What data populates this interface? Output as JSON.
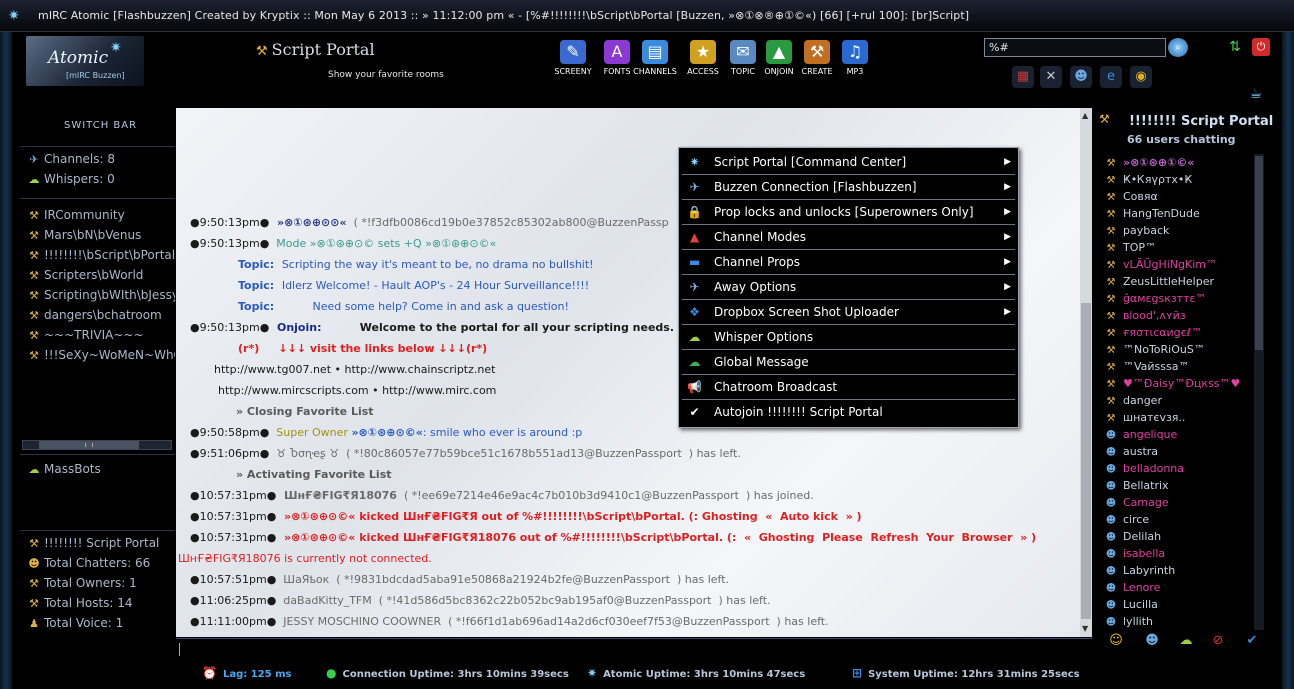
{
  "window": {
    "title": "mIRC Atomic [Flashbuzzen] Created by Kryptix :: Mon May 6 2013 :: » 11:12:00 pm « - [%#!!!!!!!!\\bScript\\bPortal [Buzzen, »⊗①⊗®⊕①©«) [66] [+rul 100]: [br]Script]"
  },
  "header": {
    "logo_text": "Atomic",
    "logo_sub": "[mIRC Buzzen]",
    "portal_title": "Script Portal",
    "portal_subtitle": "Show your favorite rooms",
    "toolbar": [
      {
        "name": "screeny",
        "label": "SCREENY",
        "glyph": "✎",
        "color": "#3a6ad0"
      },
      {
        "name": "fonts",
        "label": "FONTS",
        "glyph": "A",
        "color": "#8a3ad0"
      },
      {
        "name": "channels",
        "label": "CHANNELS",
        "glyph": "▤",
        "color": "#3a8ae0"
      },
      {
        "name": "access",
        "label": "ACCESS",
        "glyph": "★",
        "color": "#d0a020"
      },
      {
        "name": "topic",
        "label": "TOPIC",
        "glyph": "✉",
        "color": "#5a88c0"
      },
      {
        "name": "onjoin",
        "label": "ONJOIN",
        "glyph": "▲",
        "color": "#2a9a40"
      },
      {
        "name": "create",
        "label": "CREATE",
        "glyph": "⚒",
        "color": "#c07020"
      },
      {
        "name": "mp3",
        "label": "MP3",
        "glyph": "♫",
        "color": "#2a6ad0"
      }
    ],
    "search_value": "%#",
    "hicons": [
      {
        "name": "users-grid-icon",
        "glyph": "▦",
        "color": "#c03a3a"
      },
      {
        "name": "tools-icon",
        "glyph": "✕",
        "color": "#c8c8c8"
      },
      {
        "name": "group-icon",
        "glyph": "☻",
        "color": "#6aa8e0"
      },
      {
        "name": "ie-icon",
        "glyph": "e",
        "color": "#3a8ae0"
      },
      {
        "name": "chrome-icon",
        "glyph": "◉",
        "color": "#e0b020"
      }
    ]
  },
  "sidebar": {
    "switch_bar_label": "SWITCH BAR",
    "stats": [
      {
        "label": "Channels: 8",
        "glyph": "✈"
      },
      {
        "label": "Whispers: 0",
        "glyph": "☁"
      }
    ],
    "channels": [
      "IRCommunity",
      "Mars\\bN\\bVenus",
      "!!!!!!!!\\bScript\\bPortal",
      "Scripters\\bWorld",
      "Scripting\\bWIth\\bJessy",
      "dangers\\bchatroom",
      "~~~TRIVIA~~~",
      "!!!SeXy~WoMeN~WhO~\\"
    ],
    "massbots": "MassBots",
    "room_info": [
      {
        "label": "!!!!!!!! Script Portal",
        "glyph": "⚒"
      },
      {
        "label": "Total Chatters: 66",
        "glyph": "☻"
      },
      {
        "label": "Total Owners: 1",
        "glyph": "⚒"
      },
      {
        "label": "Total Hosts: 14",
        "glyph": "⚒"
      },
      {
        "label": "Total Voice: 1",
        "glyph": "♟"
      }
    ]
  },
  "chat": {
    "lines": [
      {
        "ts": "●9:50:13pm●",
        "parts": [
          {
            "t": "  »⊗①⊛⊕⊙⊙«",
            "c": "#2a3a8a",
            "b": true
          },
          {
            "t": "  ( *!f3dfb0086cd19b0e37852c85302ab800@BuzzenPassp",
            "c": "#6a6a6a"
          }
        ]
      },
      {
        "ts": "●9:50:13pm●",
        "parts": [
          {
            "t": "  Mode »⊗①⊛⊕⊙© sets +Q »⊗①⊛⊕⊙©«",
            "c": "#3a9a8a"
          }
        ]
      },
      {
        "ts": "",
        "indent": 48,
        "parts": [
          {
            "t": "Topic:  ",
            "c": "#2a5ac0",
            "b": true
          },
          {
            "t": "Scripting the way it's meant to be, no drama no bullshit!",
            "c": "#2a5ac0"
          }
        ]
      },
      {
        "ts": "",
        "indent": 48,
        "parts": [
          {
            "t": "Topic:  ",
            "c": "#2a5ac0",
            "b": true
          },
          {
            "t": "Idlerz Welcome! - Hault AOP's - 24 Hour Surveillance!!!!",
            "c": "#2a5ac0"
          }
        ]
      },
      {
        "ts": "",
        "indent": 48,
        "parts": [
          {
            "t": "Topic:          ",
            "c": "#2a5ac0",
            "b": true
          },
          {
            "t": "Need some help? Come in and ask a question!",
            "c": "#2a5ac0"
          }
        ]
      },
      {
        "ts": "●9:50:13pm●",
        "parts": [
          {
            "t": "  Onjoin:          ",
            "c": "#1a2a8a",
            "b": true
          },
          {
            "t": "Welcome to the portal for all your scripting needs. (~)",
            "c": "#1a1a1a",
            "b": true
          }
        ]
      },
      {
        "ts": "",
        "indent": 48,
        "parts": [
          {
            "t": "(r*)     ↓↓↓ visit the links below ↓↓↓(r*)",
            "c": "#e02020",
            "b": true
          }
        ]
      },
      {
        "ts": "",
        "indent": 24,
        "parts": [
          {
            "t": "http://www.tg007.net • http://www.chainscriptz.net",
            "c": "#1a1a1a"
          }
        ]
      },
      {
        "ts": "",
        "indent": 28,
        "parts": [
          {
            "t": "http://www.mircscripts.com • http://www.mirc.com",
            "c": "#1a1a1a"
          }
        ]
      },
      {
        "ts": "",
        "indent": 46,
        "parts": [
          {
            "t": "» Closing Favorite List",
            "c": "#5a5a5a",
            "b": true
          }
        ]
      },
      {
        "ts": "●9:50:58pm●",
        "parts": [
          {
            "t": "  Super Owner ",
            "c": "#a09010"
          },
          {
            "t": "»⊗①⊛⊕⊙©«",
            "c": "#2a5ac0",
            "b": true
          },
          {
            "t": ": smile who ever is around :p",
            "c": "#2a5ac0"
          }
        ]
      },
      {
        "ts": "●9:51:06pm●",
        "parts": [
          {
            "t": "  ♉ Ⴆσɳҽʂ ♉  ( *!80c86057e77b59bce51c1678b551ad13@BuzzenPassport  ) has left.",
            "c": "#6a6a6a"
          }
        ]
      },
      {
        "ts": "",
        "indent": 46,
        "parts": [
          {
            "t": "» Activating Favorite List",
            "c": "#5a5a5a",
            "b": true
          }
        ]
      },
      {
        "ts": "●10:57:31pm●",
        "parts": [
          {
            "t": "  ШнҒ₴FIG₹Я18076",
            "c": "#6a6a6a",
            "b": true
          },
          {
            "t": "  ( *!ee69e7214e46e9ac4c7b010b3d9410c1@BuzzenPassport  ) has joined.",
            "c": "#6a6a6a"
          }
        ]
      },
      {
        "ts": "●10:57:31pm●",
        "parts": [
          {
            "t": "  »⊗①⊛⊕⊙©« kicked ШнҒ₴FIG₹Я out of %#!!!!!!!!\\bScript\\bPortal. (: Ghosting  «  Auto kick  » )",
            "c": "#e02020",
            "b": true
          }
        ]
      },
      {
        "ts": "●10:57:31pm●",
        "parts": [
          {
            "t": "  »⊗①⊛⊕⊙©« kicked ШнҒ₴FIG₹Я18076 out of %#!!!!!!!!\\bScript\\bPortal. (:  «  Ghosting  Please  Refresh  Your  Browser  » )",
            "c": "#e02020",
            "b": true
          }
        ]
      },
      {
        "ts": "",
        "indent": -12,
        "parts": [
          {
            "t": "ШнҒ₴FIG₹Я18076 is currently not connected.",
            "c": "#e02020"
          }
        ]
      },
      {
        "ts": "●10:57:51pm●",
        "parts": [
          {
            "t": "  ШаЯҍок  ( *!9831bdcdad5aba91e50868a21924b2fe@BuzzenPassport  ) has left.",
            "c": "#6a6a6a"
          }
        ]
      },
      {
        "ts": "●11:06:25pm●",
        "parts": [
          {
            "t": "  daBadKitty_TFM  ( *!41d586d5bc8362c22b052bc9ab195af0@BuzzenPassport  ) has left.",
            "c": "#6a6a6a"
          }
        ]
      },
      {
        "ts": "●11:11:00pm●",
        "parts": [
          {
            "t": "  JESSY MOSCHINO COOWNER  ( *!f66f1d1ab696ad14a2d6cf030eef7f53@BuzzenPassport  ) has left.",
            "c": "#6a6a6a"
          }
        ]
      }
    ]
  },
  "menu": {
    "items": [
      {
        "label": "Script Portal [Command Center]",
        "glyph": "✷",
        "color": "#7fd3ff",
        "arrow": true
      },
      {
        "label": "Buzzen Connection [Flashbuzzen]",
        "glyph": "✈",
        "color": "#7ab0e0",
        "arrow": true
      },
      {
        "label": "Prop locks and unlocks [Superowners Only]",
        "glyph": "🔒",
        "color": "#e0b040",
        "arrow": true
      },
      {
        "label": "Channel Modes",
        "glyph": "▲",
        "color": "#e04040",
        "arrow": true
      },
      {
        "label": "Channel Props",
        "glyph": "▬",
        "color": "#3a8ae0",
        "arrow": true
      },
      {
        "label": "Away Options",
        "glyph": "✈",
        "color": "#7ab0e0",
        "arrow": true
      },
      {
        "label": "Dropbox Screen Shot Uploader",
        "glyph": "❖",
        "color": "#3a8ae0",
        "arrow": true
      },
      {
        "label": "Whisper Options",
        "glyph": "☁",
        "color": "#a0d040",
        "arrow": false
      },
      {
        "label": "Global Message",
        "glyph": "☁",
        "color": "#40b060",
        "arrow": false
      },
      {
        "label": "Chatroom Broadcast",
        "glyph": "📢",
        "color": "#c8c8c8",
        "arrow": false
      },
      {
        "label": "Autojoin  !!!!!!!! Script Portal",
        "glyph": "✔",
        "color": "#ffffff",
        "arrow": false
      }
    ]
  },
  "room": {
    "name": "!!!!!!!! Script Portal",
    "count": "66 users chatting"
  },
  "nicks": [
    {
      "n": "»⊗①⊛⊕①©«",
      "c": "#c060d0",
      "g": "⚒",
      "gc": "#e0b040",
      "b": true
    },
    {
      "n": "Ҝ•Ꮶяүρтх•Ҝ",
      "c": "#c8d4e4",
      "g": "⚒",
      "gc": "#e0b040"
    },
    {
      "n": "Cовяα",
      "c": "#c8d4e4",
      "g": "⚒",
      "gc": "#e0b040"
    },
    {
      "n": "HangTenDude",
      "c": "#c8d4e4",
      "g": "⚒",
      "gc": "#e0b040"
    },
    {
      "n": "payback",
      "c": "#c8d4e4",
      "g": "⚒",
      "gc": "#e0b040"
    },
    {
      "n": "TOP™",
      "c": "#c8d4e4",
      "g": "⚒",
      "gc": "#e0b040"
    },
    {
      "n": "vLÃÜgHiNgKim™",
      "c": "#e040a0",
      "g": "⚒",
      "gc": "#e0b040"
    },
    {
      "n": "ZeusLittleHelper",
      "c": "#c8d4e4",
      "g": "⚒",
      "gc": "#e0b040"
    },
    {
      "n": "ğαмɛgѕкɜттɛ™",
      "c": "#e040a0",
      "g": "⚒",
      "gc": "#e0b040"
    },
    {
      "n": "ʙlood',ʌʏйз",
      "c": "#e040a0",
      "g": "⚒",
      "gc": "#e0b040"
    },
    {
      "n": "ғяσтιcαиgєℓ™",
      "c": "#e040a0",
      "g": "⚒",
      "gc": "#e0b040"
    },
    {
      "n": "™NoToRiOuS™",
      "c": "#c8d4e4",
      "g": "⚒",
      "gc": "#e0b040"
    },
    {
      "n": "™Vaйsssa™",
      "c": "#c8d4e4",
      "g": "⚒",
      "gc": "#e0b040"
    },
    {
      "n": "♥™Ðaisy™Ðцкѕѕ™♥",
      "c": "#e040a0",
      "g": "⚒",
      "gc": "#e0b040"
    },
    {
      "n": "danger",
      "c": "#c8d4e4",
      "g": "⚒",
      "gc": "#e0b040"
    },
    {
      "n": "шнатєvзя..",
      "c": "#c8d4e4",
      "g": "⚒",
      "gc": "#e0b040"
    },
    {
      "n": "angelique",
      "c": "#e040a0",
      "g": "☻",
      "gc": "#6aa8e0"
    },
    {
      "n": "austra",
      "c": "#c8d4e4",
      "g": "☻",
      "gc": "#6aa8e0"
    },
    {
      "n": "belladonna",
      "c": "#e040a0",
      "g": "☻",
      "gc": "#6aa8e0"
    },
    {
      "n": "Bellatrix",
      "c": "#c8d4e4",
      "g": "☻",
      "gc": "#6aa8e0"
    },
    {
      "n": "Camage",
      "c": "#e040a0",
      "g": "☻",
      "gc": "#6aa8e0"
    },
    {
      "n": "circe",
      "c": "#c8d4e4",
      "g": "☻",
      "gc": "#6aa8e0"
    },
    {
      "n": "Delilah",
      "c": "#c8d4e4",
      "g": "☻",
      "gc": "#6aa8e0"
    },
    {
      "n": "isabella",
      "c": "#e040a0",
      "g": "☻",
      "gc": "#6aa8e0"
    },
    {
      "n": "Labyrinth",
      "c": "#c8d4e4",
      "g": "☻",
      "gc": "#6aa8e0"
    },
    {
      "n": "Lenore",
      "c": "#e040a0",
      "g": "☻",
      "gc": "#6aa8e0"
    },
    {
      "n": "Lucilla",
      "c": "#c8d4e4",
      "g": "☻",
      "gc": "#6aa8e0"
    },
    {
      "n": "lyllith",
      "c": "#c8d4e4",
      "g": "☻",
      "gc": "#6aa8e0"
    }
  ],
  "status": {
    "lag": "Lag: 125 ms",
    "connection": "Connection Uptime: 3hrs 10mins 39secs",
    "atomic": "Atomic Uptime: 3hrs 10mins 47secs",
    "system": "System Uptime: 12hrs 31mins 25secs"
  }
}
